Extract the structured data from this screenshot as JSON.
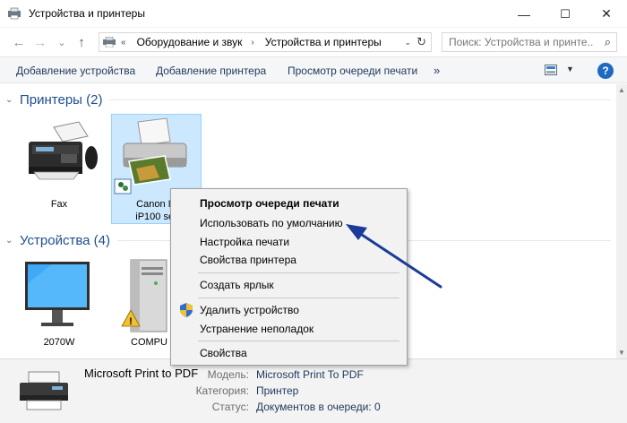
{
  "window": {
    "title": "Устройства и принтеры",
    "controls": {
      "minimize": "—",
      "maximize": "☐",
      "close": "✕"
    }
  },
  "nav": {
    "back": "←",
    "forward": "→",
    "recent": "⌄",
    "up": "↑",
    "breadcrumb": [
      "Оборудование и звук",
      "Устройства и принтеры"
    ],
    "breadcrumb_root": "«",
    "search_placeholder": "Поиск: Устройства и принте..."
  },
  "commandbar": {
    "items": [
      "Добавление устройства",
      "Добавление принтера",
      "Просмотр очереди печати"
    ],
    "more": "»",
    "help": "?"
  },
  "groups": {
    "printers": {
      "label": "Принтеры (2)"
    },
    "devices": {
      "label": "Устройства (4)"
    }
  },
  "printers": [
    {
      "name": "Fax"
    },
    {
      "name_line1": "Canon In",
      "name_line2": "iP100 ser"
    }
  ],
  "devices": [
    {
      "name": "2070W"
    },
    {
      "name": "COMPU"
    }
  ],
  "context_menu": {
    "items": [
      {
        "label": "Просмотр очереди печати",
        "bold": true
      },
      {
        "label": "Использовать по умолчанию"
      },
      {
        "label": "Настройка печати"
      },
      {
        "label": "Свойства принтера"
      },
      {
        "label": "Создать ярлык"
      },
      {
        "label": "Удалить устройство",
        "icon": "uac-shield-icon"
      },
      {
        "label": "Устранение неполадок"
      },
      {
        "label": "Свойства"
      }
    ]
  },
  "details": {
    "device_name": "Microsoft Print to PDF",
    "model_key": "Модель:",
    "model_value": "Microsoft Print To PDF",
    "category_key": "Категория:",
    "category_value": "Принтер",
    "status_key": "Статус:",
    "status_value": "Документов в очереди: 0"
  },
  "colors": {
    "accent": "#1e6ac1",
    "selection": "#cce8ff",
    "group_header": "#1e4e8c",
    "annotation_arrow": "#1b3a9a"
  }
}
